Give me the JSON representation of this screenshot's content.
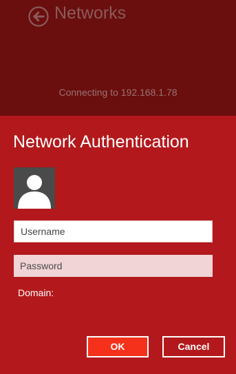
{
  "header": {
    "title": "Networks",
    "back_icon": "back-arrow-circle-icon"
  },
  "status": {
    "connecting_text": "Connecting to 192.168.1.78"
  },
  "dialog": {
    "title": "Network Authentication",
    "avatar_icon": "user-silhouette-icon",
    "username": {
      "value": "",
      "placeholder": "Username"
    },
    "password": {
      "value": "",
      "placeholder": "Password"
    },
    "domain_label": "Domain:",
    "ok_label": "OK",
    "cancel_label": "Cancel"
  },
  "colors": {
    "top_panel": "#6a0e0e",
    "dialog_background": "#b3191c",
    "ok_button": "#f5311b"
  }
}
